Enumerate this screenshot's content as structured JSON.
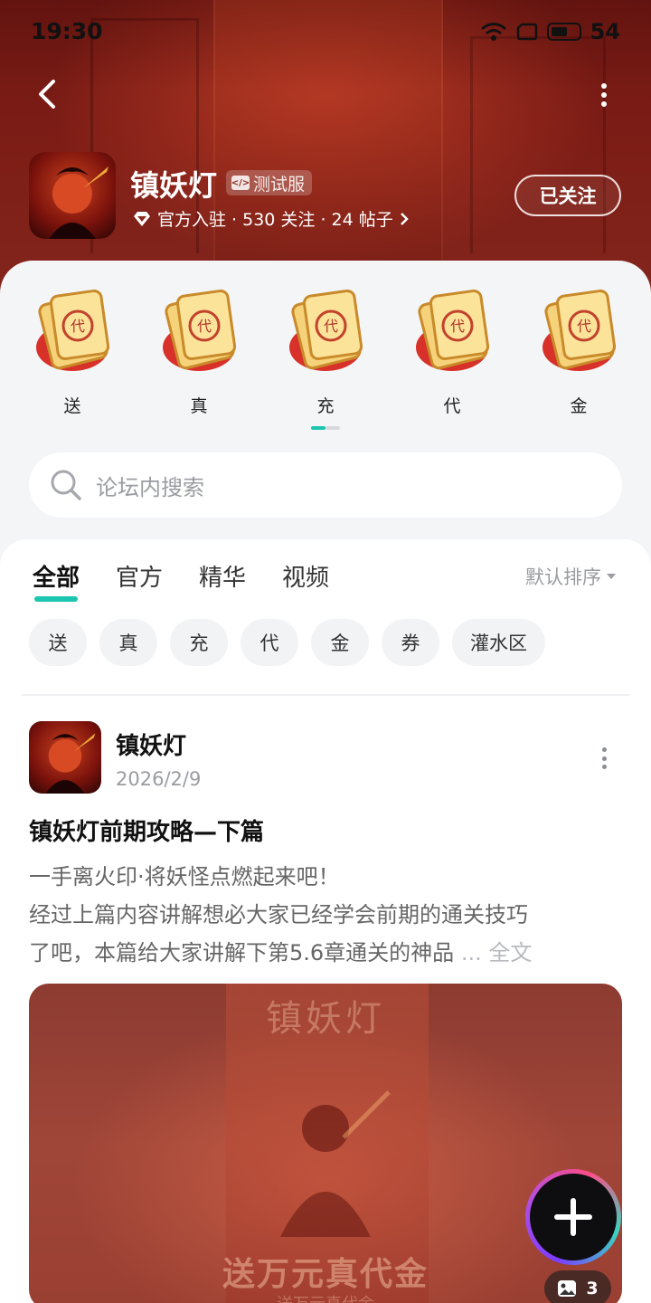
{
  "status_bar": {
    "time": "19:30",
    "battery": "54"
  },
  "header": {
    "game_title": "镇妖灯",
    "beta_label": "测试服",
    "meta": "官方入驻 · 530 关注 · 24 帖子",
    "follow_label": "已关注"
  },
  "cards": [
    {
      "label": "送"
    },
    {
      "label": "真"
    },
    {
      "label": "充"
    },
    {
      "label": "代"
    },
    {
      "label": "金"
    }
  ],
  "search": {
    "placeholder": "论坛内搜索"
  },
  "tabs": [
    {
      "label": "全部",
      "active": true
    },
    {
      "label": "官方"
    },
    {
      "label": "精华"
    },
    {
      "label": "视频"
    }
  ],
  "sort_label": "默认排序",
  "chips": [
    "送",
    "真",
    "充",
    "代",
    "金",
    "券",
    "灌水区"
  ],
  "post": {
    "author": "镇妖灯",
    "date": "2026/2/9",
    "title": "镇妖灯前期攻略—下篇",
    "body_line1": "一手离火印·将妖怪点燃起来吧！",
    "body_line2": " 经过上篇内容讲解想必大家已经学会前期的通关技巧",
    "body_line3": "了吧，本篇给大家讲解下第5.6章通关的神品",
    "ellipsis": "...",
    "full_text": "全文",
    "image_logo": "镇妖灯",
    "image_slogan": "送万元真代金",
    "image_sub": "送万元真代金",
    "image_count": "3"
  },
  "icons": [
    "back-arrow-icon",
    "more-icon",
    "wifi-icon",
    "sim-icon",
    "battery-icon",
    "code-icon",
    "diamond-icon",
    "chevron-right-icon",
    "search-icon",
    "image-icon",
    "plus-icon"
  ],
  "colors": {
    "accent": "#1bc5b0",
    "banner": "#7e1d16"
  }
}
